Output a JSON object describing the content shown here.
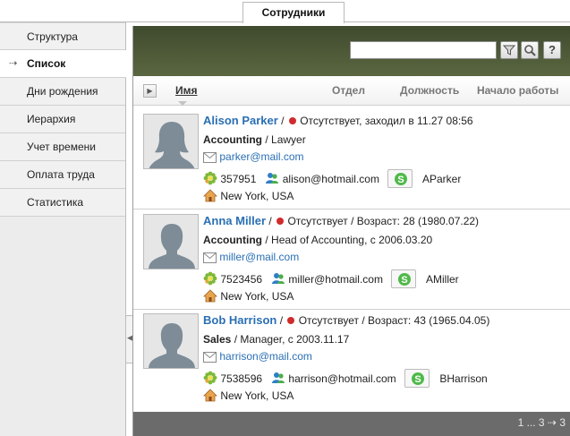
{
  "top_tab": "Сотрудники",
  "sidebar": {
    "items": [
      {
        "label": "Структура"
      },
      {
        "label": "Список",
        "active": true
      },
      {
        "label": "Дни рождения"
      },
      {
        "label": "Иерархия"
      },
      {
        "label": "Учет времени"
      },
      {
        "label": "Оплата труда"
      },
      {
        "label": "Статистика"
      }
    ],
    "active_marker": "⇢"
  },
  "toolbar": {
    "search_value": "",
    "filter_icon": "filter-icon",
    "search_icon": "search-icon",
    "help_label": "?"
  },
  "columns": {
    "name": "Имя",
    "department": "Отдел",
    "position": "Должность",
    "start": "Начало работы"
  },
  "employees": [
    {
      "name": "Alison Parker",
      "sep": "/",
      "status": "Отсутствует, заходил в 11.27 08:56",
      "department": "Accounting",
      "position": "Lawyer",
      "email": "parker@mail.com",
      "icq": "357951",
      "msn": "alison@hotmail.com",
      "skype": "AParker",
      "location": "New York, USA"
    },
    {
      "name": "Anna Miller",
      "sep": "/",
      "status": "Отсутствует / Возраст: 28 (1980.07.22)",
      "department": "Accounting",
      "position": "Head of Accounting, с 2006.03.20",
      "email": "miller@mail.com",
      "icq": "7523456",
      "msn": "miller@hotmail.com",
      "skype": "AMiller",
      "location": "New York, USA"
    },
    {
      "name": "Bob Harrison",
      "sep": "/",
      "status": "Отсутствует / Возраст: 43 (1965.04.05)",
      "department": "Sales",
      "position": "Manager, с 2003.11.17",
      "email": "harrison@mail.com",
      "icq": "7538596",
      "msn": "harrison@hotmail.com",
      "skype": "BHarrison",
      "location": "New York, USA"
    }
  ],
  "pager": "1 ... 3 ⇢ 3",
  "colors": {
    "toolbar": "#4b5636",
    "link": "#2a6fb4",
    "status_dot": "#d12b2b",
    "footer": "#6b6b6b"
  }
}
